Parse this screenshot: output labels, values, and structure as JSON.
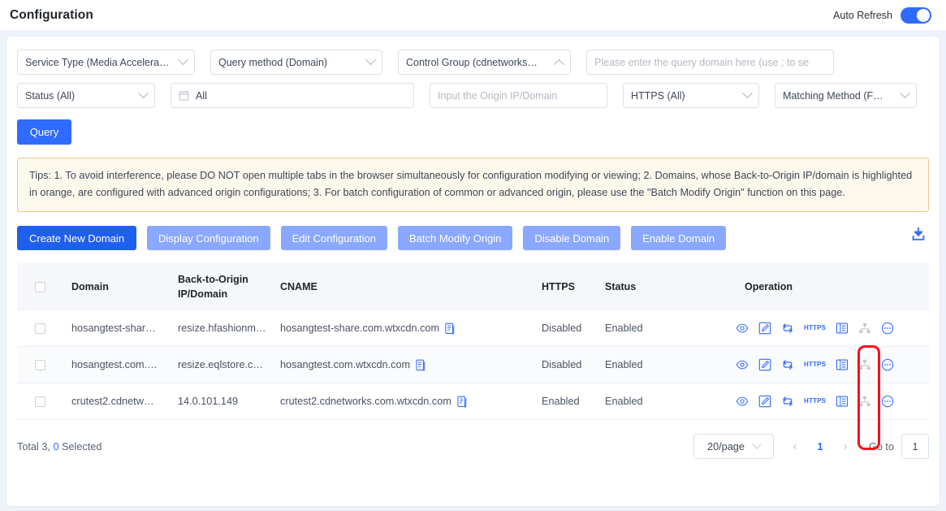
{
  "header": {
    "title": "Configuration",
    "auto_refresh_label": "Auto Refresh",
    "auto_refresh_on": true
  },
  "filters": {
    "service_type": "Service Type (Media Accelera…",
    "query_method": "Query method (Domain)",
    "control_group": "Control Group (cdnetworks…",
    "domain_placeholder": "Please enter the query domain here (use ; to se",
    "status": "Status (All)",
    "date_range": "All",
    "origin_placeholder": "Input the Origin IP/Domain",
    "https": "HTTPS (All)",
    "matching_method": "Matching Method (F…",
    "query_button": "Query"
  },
  "tips": "Tips: 1. To avoid interference, please DO NOT open multiple tabs in the browser simultaneously for configuration modifying or viewing; 2. Domains, whose Back-to-Origin IP/domain is highlighted in orange, are configured with advanced origin configurations; 3. For batch configuration of common or advanced origin, please use the \"Batch Modify Origin\" function on this page.",
  "actions": {
    "create_new_domain": "Create New Domain",
    "display_configuration": "Display Configuration",
    "edit_configuration": "Edit Configuration",
    "batch_modify_origin": "Batch Modify Origin",
    "disable_domain": "Disable Domain",
    "enable_domain": "Enable Domain",
    "download_icon": "download-icon"
  },
  "table": {
    "columns": {
      "domain": "Domain",
      "origin_line1": "Back-to-Origin",
      "origin_line2": "IP/Domain",
      "cname": "CNAME",
      "https": "HTTPS",
      "status": "Status",
      "operation": "Operation"
    },
    "rows": [
      {
        "domain": "hosangtest-shar…",
        "origin": "resize.hfashionm…",
        "cname": "hosangtest-share.com.wtxcdn.com",
        "https": "Disabled",
        "status": "Enabled"
      },
      {
        "domain": "hosangtest.com.…",
        "origin": "resize.eqlstore.c…",
        "cname": "hosangtest.com.wtxcdn.com",
        "https": "Disabled",
        "status": "Enabled"
      },
      {
        "domain": "crutest2.cdnetw…",
        "origin": "14.0.101.149",
        "cname": "crutest2.cdnetworks.com.wtxcdn.com",
        "https": "Enabled",
        "status": "Enabled"
      }
    ],
    "operation_icons": {
      "view": "eye-icon",
      "edit": "edit-pencil-icon",
      "sync": "refresh-sync-icon",
      "https": "HTTPS",
      "list": "list-table-icon",
      "hierarchy": "hierarchy-nodes-icon",
      "more": "more-dots-icon"
    }
  },
  "footer": {
    "total_prefix": "Total 3,",
    "selected_count": "0",
    "selected_suffix": "Selected",
    "page_size": "20/page",
    "prev": "‹",
    "page_number": "1",
    "next": "›",
    "goto_label": "Go to",
    "goto_value": "1"
  },
  "colors": {
    "accent": "#2f6bff",
    "primary_button": "#1f5fef",
    "secondary_button": "#8aa8ff",
    "highlight_box": "#fc0d1b",
    "tips_border": "#e8c98a",
    "tips_bg": "#fdf8ec"
  }
}
